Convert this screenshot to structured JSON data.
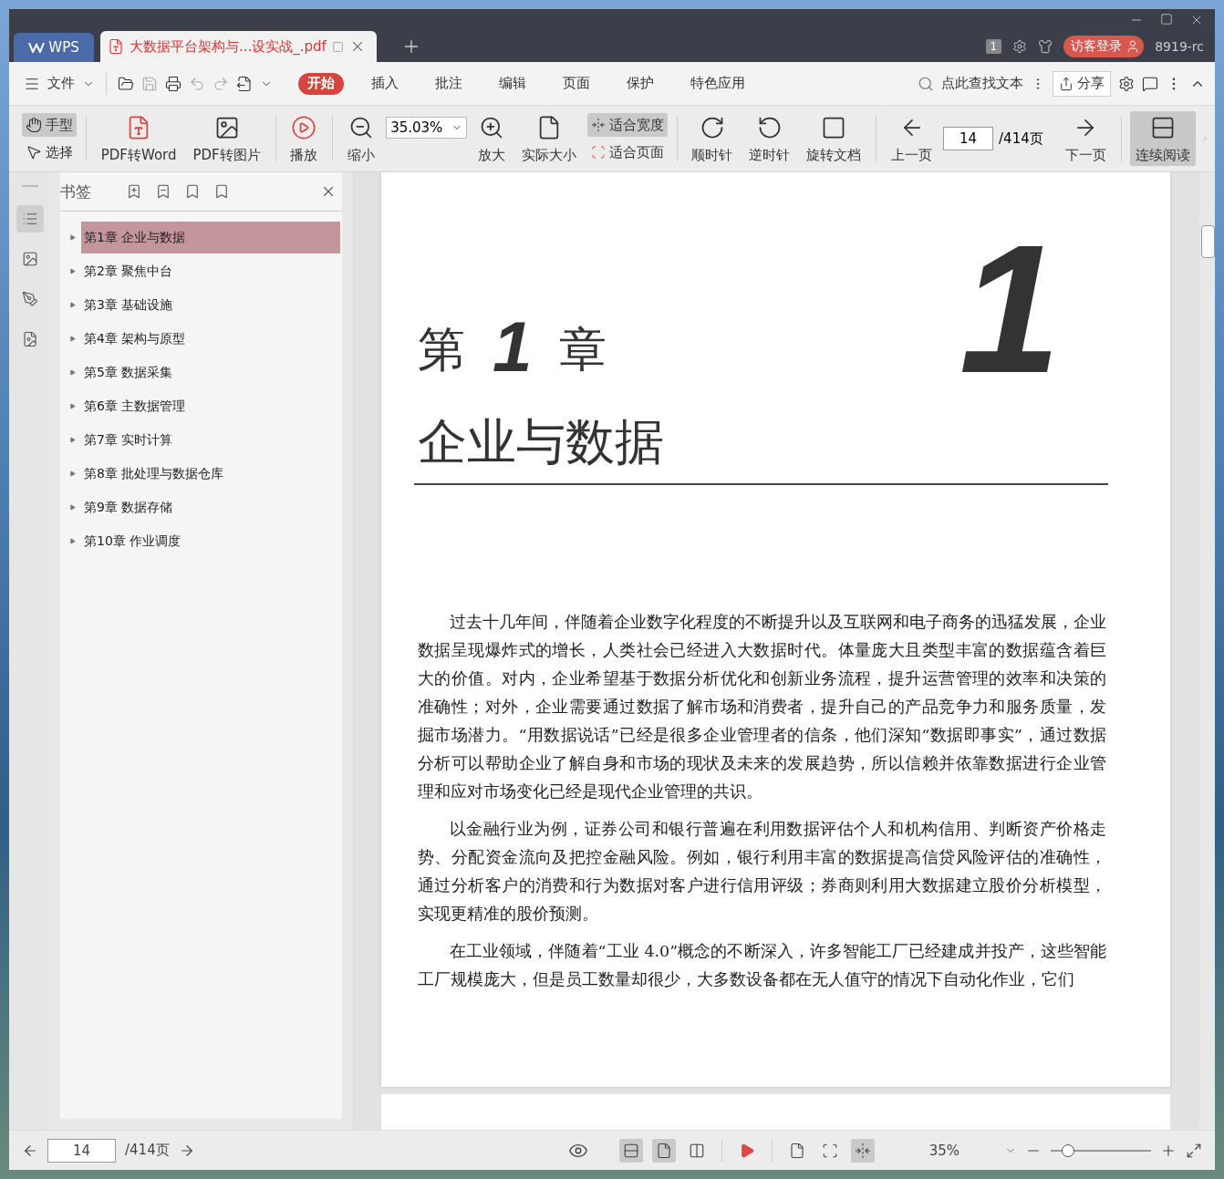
{
  "title_bar": {
    "app_tab": "WPS",
    "doc_tab": {
      "title": "大数据平台架构与...设实战_.pdf",
      "selected": true
    },
    "page_badge": "1",
    "login_button": "访客登录",
    "user": "8919-rc"
  },
  "menu_bar": {
    "file_menu": "文件",
    "tabs": [
      {
        "label": "开始",
        "selected": true
      },
      {
        "label": "插入",
        "selected": false
      },
      {
        "label": "批注",
        "selected": false
      },
      {
        "label": "编辑",
        "selected": false
      },
      {
        "label": "页面",
        "selected": false
      },
      {
        "label": "保护",
        "selected": false
      },
      {
        "label": "特色应用",
        "selected": false
      }
    ],
    "search": "点此查找文本",
    "share": "分享"
  },
  "toolbar": {
    "hand": {
      "label": "手型",
      "selected": true
    },
    "select": {
      "label": "选择",
      "selected": false
    },
    "pdf_to_word": "PDF转Word",
    "pdf_to_image": "PDF转图片",
    "play": "播放",
    "zoom_out": "缩小",
    "zoom_value": "35.03%",
    "zoom_in": "放大",
    "actual_size": "实际大小",
    "fit_width": {
      "label": "适合宽度",
      "selected": true
    },
    "fit_page": {
      "label": "适合页面",
      "selected": false
    },
    "rotate_cw": "顺时针",
    "rotate_ccw": "逆时针",
    "rotate_doc": "旋转文档",
    "prev_page": "上一页",
    "page": "14",
    "page_total": "/414页",
    "next_page": "下一页",
    "continuous": {
      "label": "连续阅读",
      "selected": true
    }
  },
  "sidebar": {
    "title": "书签",
    "items": [
      {
        "label": "第1章 企业与数据",
        "selected": true
      },
      {
        "label": "第2章 聚焦中台",
        "selected": false
      },
      {
        "label": "第3章 基础设施",
        "selected": false
      },
      {
        "label": "第4章 架构与原型",
        "selected": false
      },
      {
        "label": "第5章 数据采集",
        "selected": false
      },
      {
        "label": "第6章 主数据管理",
        "selected": false
      },
      {
        "label": "第7章 实时计算",
        "selected": false
      },
      {
        "label": "第8章 批处理与数据仓库",
        "selected": false
      },
      {
        "label": "第9章 数据存储",
        "selected": false
      },
      {
        "label": "第10章 作业调度",
        "selected": false
      }
    ]
  },
  "document": {
    "chapter_label": "第",
    "chapter_number": "1",
    "chapter_suffix": "章",
    "big_number": "1",
    "chapter_title": "企业与数据",
    "paragraphs": [
      "过去十几年间，伴随着企业数字化程度的不断提升以及互联网和电子商务的迅猛发展，企业数据呈现爆炸式的增长，人类社会已经进入大数据时代。体量庞大且类型丰富的数据蕴含着巨大的价值。对内，企业希望基于数据分析优化和创新业务流程，提升运营管理的效率和决策的准确性；对外，企业需要通过数据了解市场和消费者，提升自己的产品竞争力和服务质量，发掘市场潜力。“用数据说话”已经是很多企业管理者的信条，他们深知“数据即事实”，通过数据分析可以帮助企业了解自身和市场的现状及未来的发展趋势，所以信赖并依靠数据进行企业管理和应对市场变化已经是现代企业管理的共识。",
      "以金融行业为例，证券公司和银行普遍在利用数据评估个人和机构信用、判断资产价格走势、分配资金流向及把控金融风险。例如，银行利用丰富的数据提高信贷风险评估的准确性，通过分析客户的消费和行为数据对客户进行信用评级；券商则利用大数据建立股价分析模型，实现更精准的股价预测。",
      "在工业领域，伴随着“工业 4.0”概念的不断深入，许多智能工厂已经建成并投产，这些智能工厂规模庞大，但是员工数量却很少，大多数设备都在无人值守的情况下自动化作业，它们"
    ]
  },
  "status_bar": {
    "page": "14",
    "page_total": "/414页",
    "views": [
      {
        "selected": true
      },
      {
        "selected": true
      },
      {
        "selected": false
      }
    ],
    "fit_actual": {
      "selected": false
    },
    "fit_page": {
      "selected": false
    },
    "fit_width": {
      "selected": true
    },
    "zoom": "35%",
    "zoom_slider": {
      "level": 0.12
    }
  }
}
